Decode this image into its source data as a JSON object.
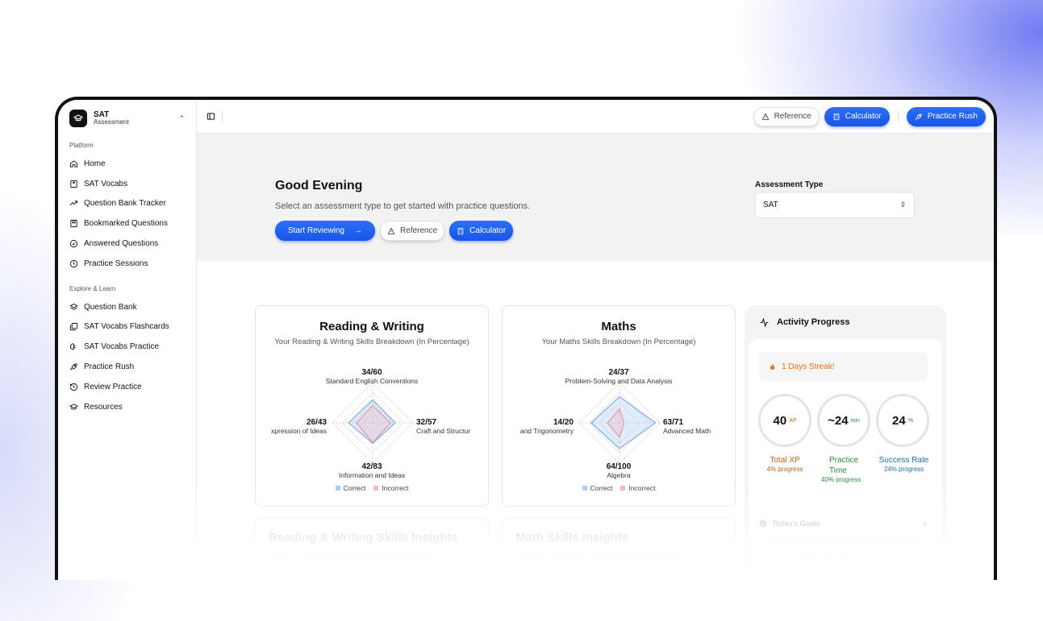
{
  "sidebar": {
    "brand_title": "SAT",
    "brand_sub": "Assessment",
    "platform_label": "Platform",
    "platform_items": [
      {
        "label": "Home",
        "icon": "home-icon"
      },
      {
        "label": "SAT Vocabs",
        "icon": "book-icon"
      },
      {
        "label": "Question Bank Tracker",
        "icon": "trend-icon"
      },
      {
        "label": "Bookmarked Questions",
        "icon": "bookmark-icon"
      },
      {
        "label": "Answered Questions",
        "icon": "check-circle-icon"
      },
      {
        "label": "Practice Sessions",
        "icon": "clock-icon"
      }
    ],
    "explore_label": "Explore & Learn",
    "explore_items": [
      {
        "label": "Question Bank",
        "icon": "layers-icon"
      },
      {
        "label": "SAT Vocabs Flashcards",
        "icon": "cards-icon"
      },
      {
        "label": "SAT Vocabs Practice",
        "icon": "brain-icon"
      },
      {
        "label": "Practice Rush",
        "icon": "rocket-icon"
      },
      {
        "label": "Review Practice",
        "icon": "history-icon"
      },
      {
        "label": "Resources",
        "icon": "graduation-cap-icon"
      }
    ]
  },
  "topbar": {
    "reference_label": "Reference",
    "calculator_label": "Calculator",
    "practice_rush_label": "Practice Rush"
  },
  "hero": {
    "title": "Good Evening",
    "subtitle": "Select an assessment type to get started with practice questions.",
    "start_label": "Start Reviewing",
    "start_arrow": "→",
    "reference_label": "Reference",
    "calculator_label": "Calculator",
    "assessment_label": "Assessment Type",
    "assessment_value": "SAT"
  },
  "rw_card": {
    "title": "Reading & Writing",
    "subtitle": "Your Reading & Writing Skills Breakdown (In Percentage)",
    "top_score": "34/60",
    "top_label": "Standard English Conventions",
    "right_score": "32/57",
    "right_label": "Craft and Structur",
    "bottom_score": "42/83",
    "bottom_label": "Information and Ideas",
    "left_score": "26/43",
    "left_label": "xpression of Ideas",
    "legend_correct": "Correct",
    "legend_incorrect": "Incorrect",
    "correct_pct": [
      0.57,
      0.56,
      0.51,
      0.6
    ],
    "incorrect_pct": [
      0.43,
      0.44,
      0.49,
      0.4
    ]
  },
  "math_card": {
    "title": "Maths",
    "subtitle": "Your Maths Skills Breakdown (In Percentage)",
    "top_score": "24/37",
    "top_label": "Problem-Solving and Data Analysis",
    "right_score": "63/71",
    "right_label": "Advanced Math",
    "bottom_score": "64/100",
    "bottom_label": "Algebra",
    "left_score": "14/20",
    "left_label": "and Trigonometry",
    "legend_correct": "Correct",
    "legend_incorrect": "Incorrect",
    "correct_pct": [
      0.65,
      0.89,
      0.64,
      0.7
    ],
    "incorrect_pct": [
      0.35,
      0.11,
      0.36,
      0.3
    ]
  },
  "insights": {
    "rw_title": "Reading & Writing Skills Insights",
    "rw_sub": "View your performance across different Reading &",
    "math_title": "Math Skills Insights",
    "math_sub": "View your performance across different Math skills."
  },
  "activity": {
    "title": "Activity Progress",
    "streak": "1 Days Streak!",
    "xp_value": "40",
    "xp_unit": "XP",
    "xp_label": "Total XP",
    "xp_progress": "4% progress",
    "time_value": "~24",
    "time_unit": "min",
    "time_label1": "Practice",
    "time_label2": "Time",
    "time_progress": "40% progress",
    "rate_value": "24",
    "rate_unit": "%",
    "rate_label": "Success Rate",
    "rate_progress": "24% progress",
    "goals_label": "Today's Goals",
    "goals_plus": "+",
    "goal_item": "Complete 10 practice"
  },
  "colors": {
    "accent": "#1a5cf0",
    "correct": "#a9c8f3",
    "incorrect": "#f2b6bf",
    "xp": "#b5631a",
    "time": "#2f8a3a",
    "rate": "#1d6ea8"
  }
}
